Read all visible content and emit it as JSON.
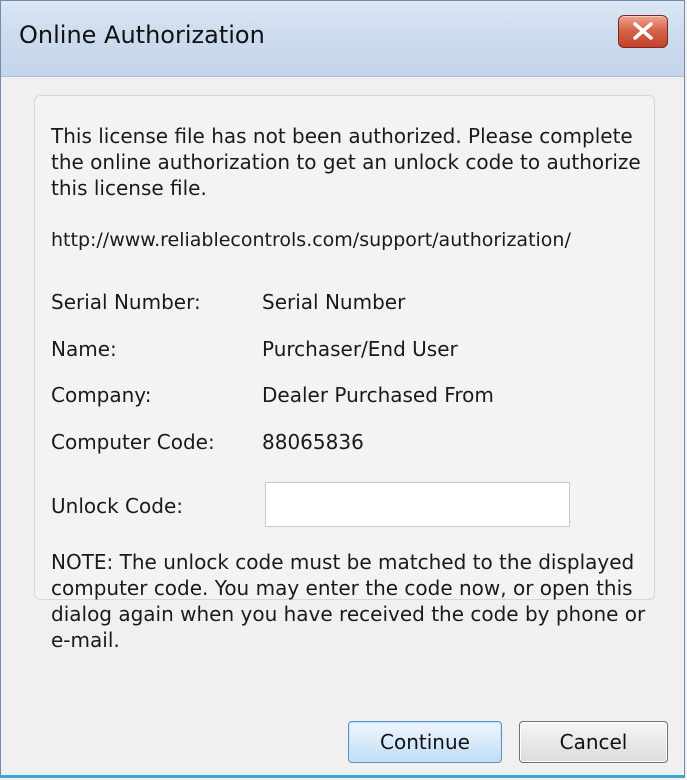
{
  "window": {
    "title": "Online Authorization"
  },
  "panel": {
    "message": "This license file has not been authorized. Please complete the online authorization to get an unlock code to authorize this license file.",
    "url": "http://www.reliablecontrols.com/support/authorization/",
    "fields": [
      {
        "label": "Serial Number:",
        "value": "Serial Number"
      },
      {
        "label": "Name:",
        "value": "Purchaser/End User"
      },
      {
        "label": "Company:",
        "value": "Dealer Purchased From"
      },
      {
        "label": "Computer Code:",
        "value": "88065836"
      }
    ],
    "unlock": {
      "label": "Unlock Code:",
      "value": "",
      "placeholder": ""
    },
    "note": "NOTE: The unlock code must be matched to the displayed computer code. You may enter the code now, or open this dialog again when you have received the code by phone or e-mail."
  },
  "buttons": {
    "continue": "Continue",
    "cancel": "Cancel"
  },
  "icons": {
    "close": "close-icon"
  },
  "colors": {
    "titlebar": "#cddbee",
    "close_button": "#c44126",
    "primary_button": "#bfdcf5",
    "border_accent": "#3aa6d8"
  }
}
